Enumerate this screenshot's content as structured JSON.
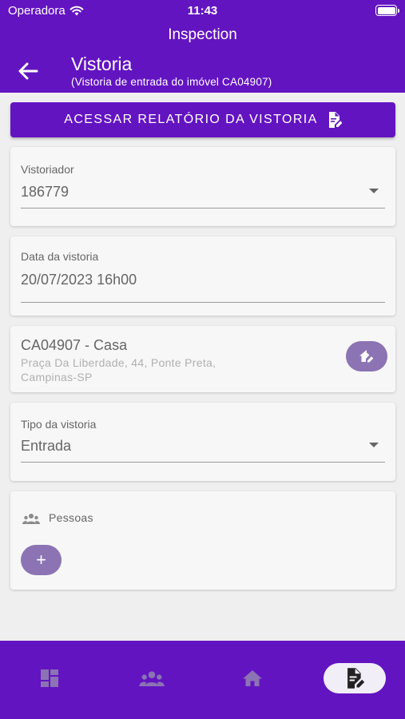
{
  "status_bar": {
    "carrier": "Operadora",
    "time": "11:43"
  },
  "app": {
    "name": "Inspection"
  },
  "header": {
    "title": "Vistoria",
    "subtitle": "(Vistoria de entrada do imóvel CA04907)"
  },
  "report_button": {
    "label": "ACESSAR RELATÓRIO DA VISTORIA"
  },
  "inspector": {
    "label": "Vistoriador",
    "value": "186779"
  },
  "date": {
    "label": "Data da vistoria",
    "value": "20/07/2023 16h00"
  },
  "property": {
    "code": "CA04907 - Casa",
    "address": "Praça Da Liberdade, 44, Ponte Preta, Campinas-SP"
  },
  "inspection_type": {
    "label": "Tipo da vistoria",
    "value": "Entrada"
  },
  "people": {
    "label": "Pessoas",
    "add_label": "+"
  },
  "colors": {
    "primary": "#6314c1",
    "accent": "#8b73b4",
    "background": "#efefef",
    "card": "#f7f7f7"
  },
  "bottom_nav": [
    {
      "icon": "dashboard-icon",
      "active": false
    },
    {
      "icon": "people-icon",
      "active": false
    },
    {
      "icon": "home-icon",
      "active": false
    },
    {
      "icon": "document-edit-icon",
      "active": true
    }
  ]
}
